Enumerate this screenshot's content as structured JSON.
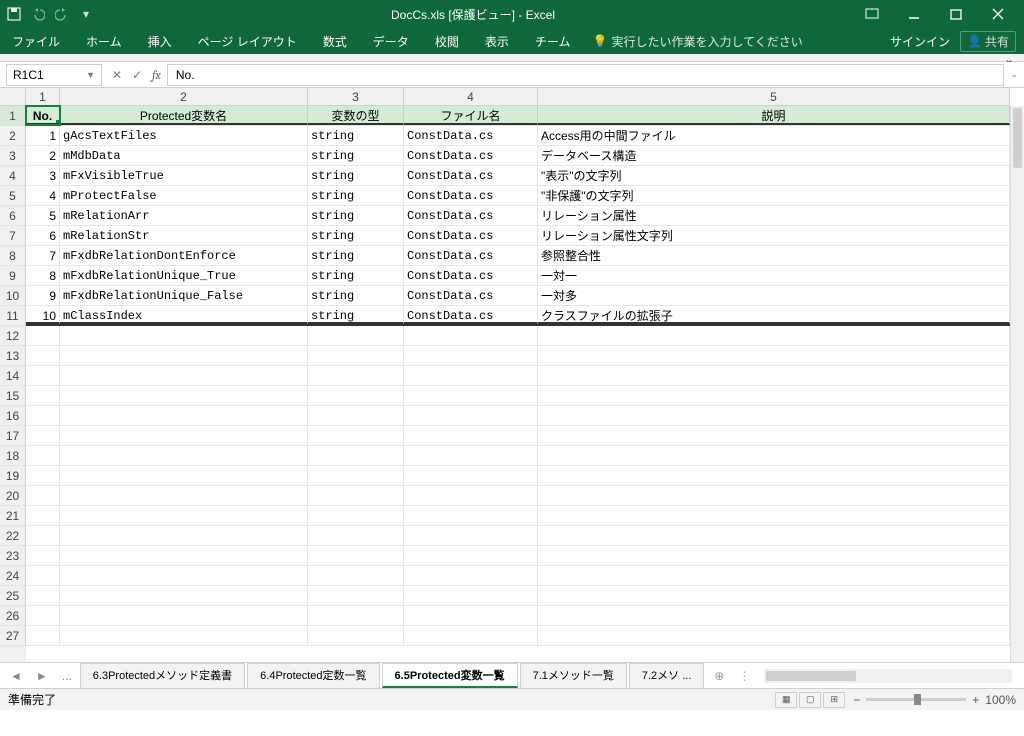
{
  "title": "DocCs.xls  [保護ビュー] - Excel",
  "qat": {
    "save": "保存",
    "undo": "元に戻す",
    "redo": "やり直し"
  },
  "ribbon": {
    "tabs": [
      "ファイル",
      "ホーム",
      "挿入",
      "ページ レイアウト",
      "数式",
      "データ",
      "校閲",
      "表示",
      "チーム"
    ],
    "tell": "実行したい作業を入力してください",
    "signin": "サインイン",
    "share": "共有"
  },
  "namebox": "R1C1",
  "formula": "No.",
  "columns": [
    "1",
    "2",
    "3",
    "4",
    "5"
  ],
  "headers": [
    "No.",
    "Protected変数名",
    "変数の型",
    "ファイル名",
    "説明"
  ],
  "rows": [
    {
      "n": "1",
      "name": "gAcsTextFiles",
      "type": "string",
      "file": "ConstData.cs",
      "desc": "Access用の中間ファイル"
    },
    {
      "n": "2",
      "name": "mMdbData",
      "type": "string",
      "file": "ConstData.cs",
      "desc": "データベース構造"
    },
    {
      "n": "3",
      "name": "mFxVisibleTrue",
      "type": "string",
      "file": "ConstData.cs",
      "desc": "\"表示\"の文字列"
    },
    {
      "n": "4",
      "name": "mProtectFalse",
      "type": "string",
      "file": "ConstData.cs",
      "desc": "\"非保護\"の文字列"
    },
    {
      "n": "5",
      "name": "mRelationArr",
      "type": "string",
      "file": "ConstData.cs",
      "desc": "リレーション属性"
    },
    {
      "n": "6",
      "name": "mRelationStr",
      "type": "string",
      "file": "ConstData.cs",
      "desc": "リレーション属性文字列"
    },
    {
      "n": "7",
      "name": "mFxdbRelationDontEnforce",
      "type": "string",
      "file": "ConstData.cs",
      "desc": "参照整合性"
    },
    {
      "n": "8",
      "name": "mFxdbRelationUnique_True",
      "type": "string",
      "file": "ConstData.cs",
      "desc": "一対一"
    },
    {
      "n": "9",
      "name": "mFxdbRelationUnique_False",
      "type": "string",
      "file": "ConstData.cs",
      "desc": "一対多"
    },
    {
      "n": "10",
      "name": "mClassIndex",
      "type": "string",
      "file": "ConstData.cs",
      "desc": "クラスファイルの拡張子"
    }
  ],
  "empty_rows_from": 12,
  "empty_rows_to": 27,
  "sheets": {
    "ellipsis": "...",
    "list": [
      "6.3Protectedメソッド定義書",
      "6.4Protected定数一覧",
      "6.5Protected変数一覧",
      "7.1メソッド一覧",
      "7.2メソ ..."
    ],
    "active": 2
  },
  "status": {
    "ready": "準備完了",
    "zoom": "100%"
  }
}
